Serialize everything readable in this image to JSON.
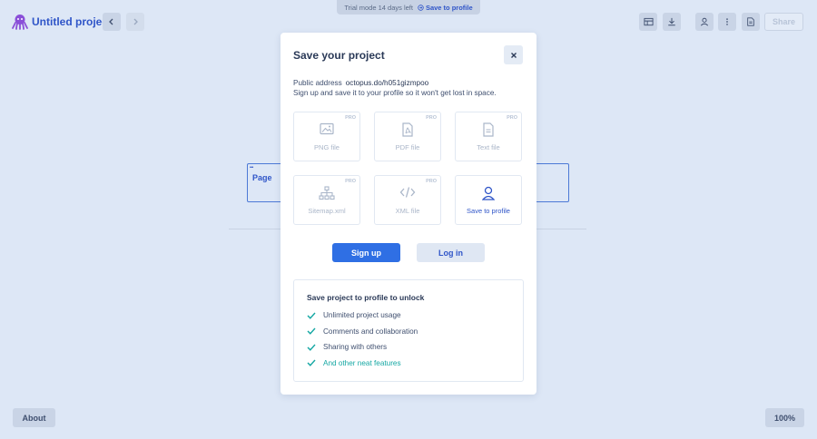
{
  "app": {
    "project_title": "Untitled project",
    "trial_text": "Trial mode 14 days left",
    "trial_save_label": "Save to profile",
    "share_label": "Share",
    "about_label": "About",
    "zoom_label": "100%"
  },
  "canvas": {
    "page_label": "Page"
  },
  "modal": {
    "title": "Save your project",
    "public_address_label": "Public address",
    "public_address_value": "octopus.do/h051gizmpoo",
    "subtext": "Sign up and save it to your profile so it won't get lost in space.",
    "pro_badge": "PRO",
    "options": [
      {
        "label": "PNG file",
        "pro": true,
        "icon": "image-icon"
      },
      {
        "label": "PDF file",
        "pro": true,
        "icon": "pdf-icon"
      },
      {
        "label": "Text file",
        "pro": true,
        "icon": "text-file-icon"
      },
      {
        "label": "Sitemap.xml",
        "pro": true,
        "icon": "sitemap-icon"
      },
      {
        "label": "XML file",
        "pro": true,
        "icon": "code-icon"
      },
      {
        "label": "Save to profile",
        "pro": false,
        "icon": "user-icon"
      }
    ],
    "signup_label": "Sign up",
    "login_label": "Log in",
    "unlock": {
      "title": "Save project to profile to unlock",
      "features": [
        "Unlimited project usage",
        "Comments and collaboration",
        "Sharing with others",
        "And other neat features"
      ]
    }
  },
  "colors": {
    "background": "#dde7f6",
    "accent": "#2f55c8",
    "primary_button": "#2f6fe4",
    "check": "#14a7a3"
  }
}
